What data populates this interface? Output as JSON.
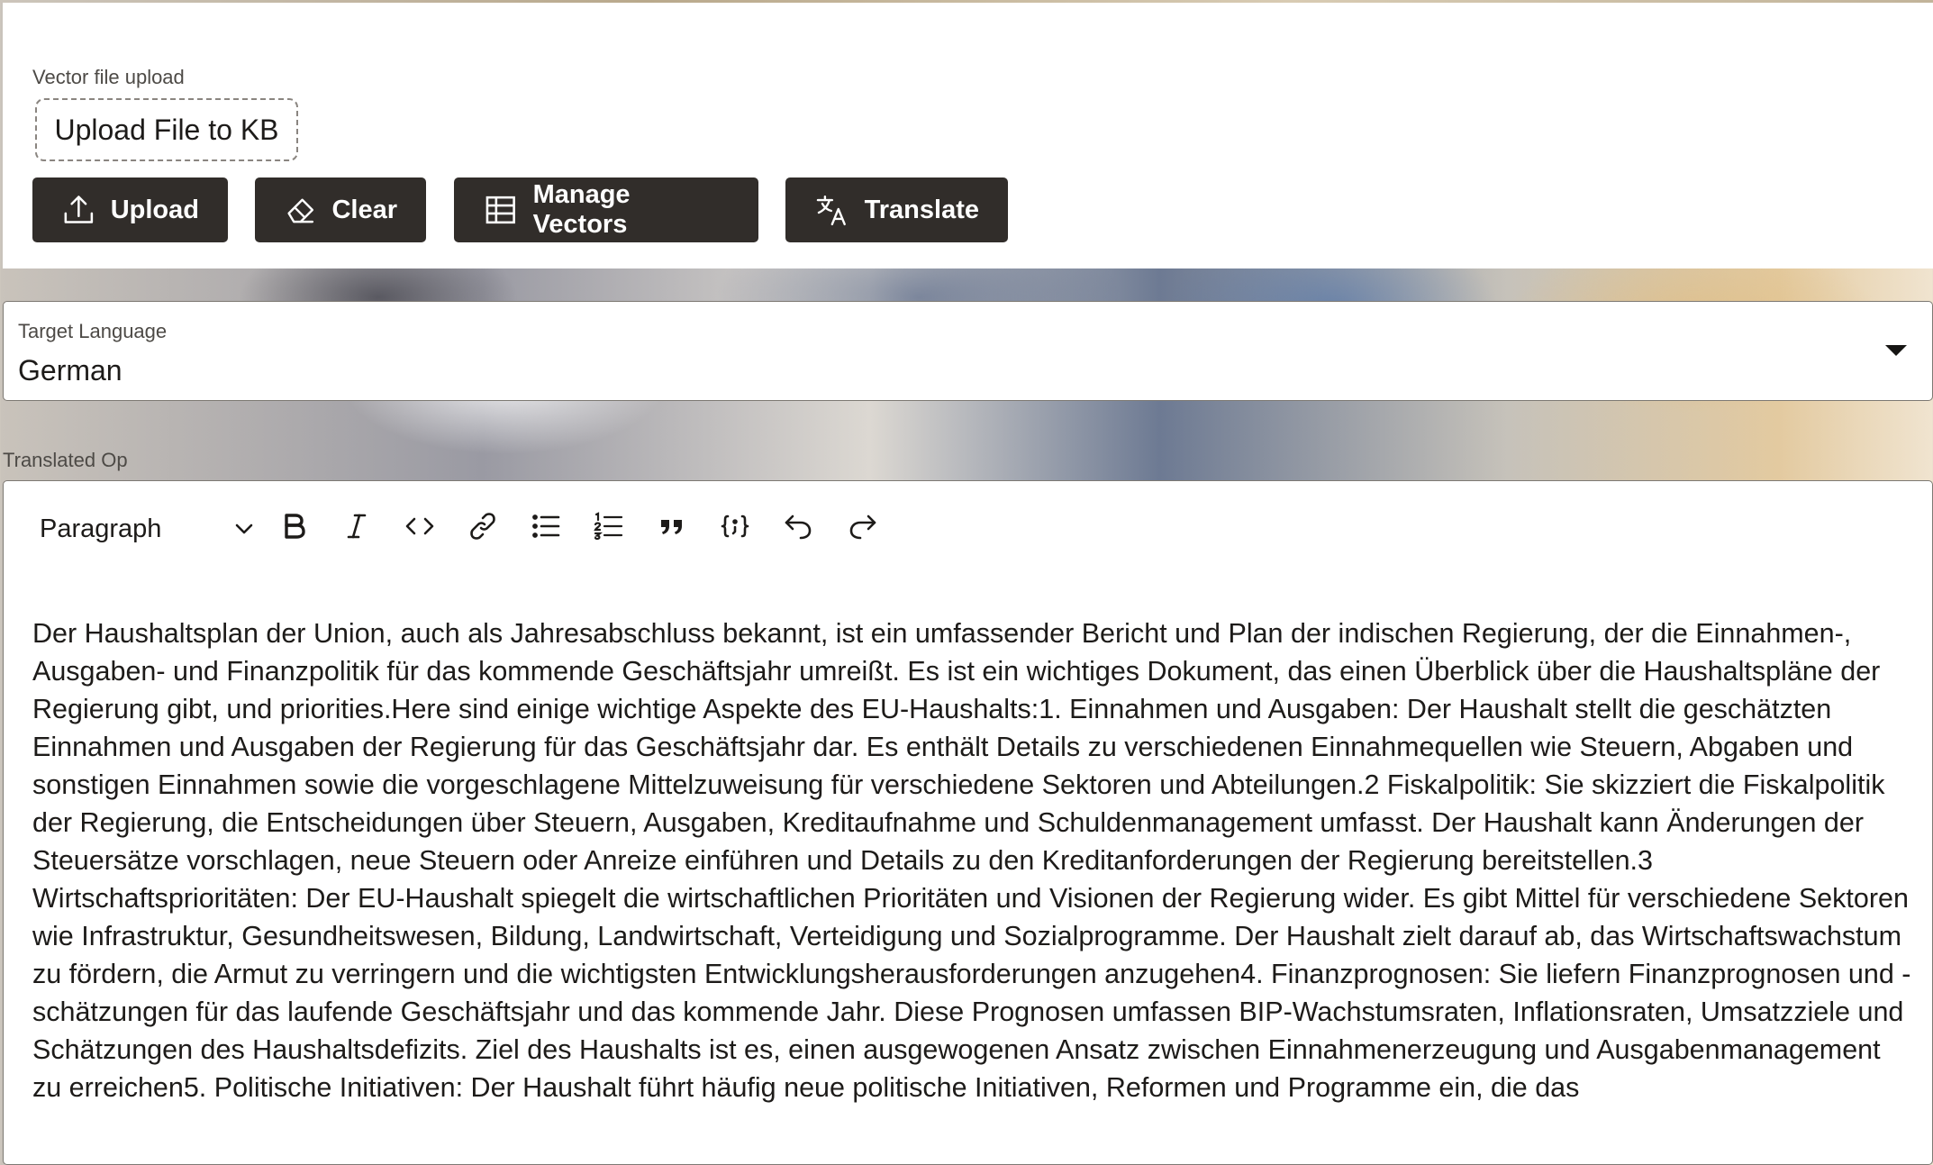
{
  "upload_section": {
    "label": "Vector file upload",
    "upload_box_text": "Upload File to KB",
    "buttons": [
      {
        "label": "Upload",
        "icon": "upload-icon"
      },
      {
        "label": "Clear",
        "icon": "eraser-icon"
      },
      {
        "label": "Manage Vectors",
        "icon": "table-icon"
      },
      {
        "label": "Translate",
        "icon": "translate-icon"
      }
    ]
  },
  "target_language": {
    "label": "Target Language",
    "value": "German"
  },
  "editor": {
    "label": "Translated Op",
    "block_format": "Paragraph",
    "toolbar_icons": [
      "bold-icon",
      "italic-icon",
      "code-icon",
      "link-icon",
      "bulleted-list-icon",
      "numbered-list-icon",
      "blockquote-icon",
      "code-block-icon",
      "undo-icon",
      "redo-icon"
    ],
    "content": "Der Haushaltsplan der Union, auch als Jahresabschluss bekannt, ist ein umfassender Bericht und Plan der indischen Regierung, der die Einnahmen-, Ausgaben- und Finanzpolitik für das kommende Geschäftsjahr umreißt. Es ist ein wichtiges Dokument, das einen Überblick über die Haushaltspläne der Regierung gibt, und priorities.Here sind einige wichtige Aspekte des EU-Haushalts:1. Einnahmen und Ausgaben: Der Haushalt stellt die geschätzten Einnahmen und Ausgaben der Regierung für das Geschäftsjahr dar. Es enthält Details zu verschiedenen Einnahmequellen wie Steuern, Abgaben und sonstigen Einnahmen sowie die vorgeschlagene Mittelzuweisung für verschiedene Sektoren und Abteilungen.2 Fiskalpolitik: Sie skizziert die Fiskalpolitik der Regierung, die Entscheidungen über Steuern, Ausgaben, Kreditaufnahme und Schuldenmanagement umfasst. Der Haushalt kann Änderungen der Steuersätze vorschlagen, neue Steuern oder Anreize einführen und Details zu den Kreditanforderungen der Regierung bereitstellen.3 Wirtschaftsprioritäten: Der EU-Haushalt spiegelt die wirtschaftlichen Prioritäten und Visionen der Regierung wider. Es gibt Mittel für verschiedene Sektoren wie Infrastruktur, Gesundheitswesen, Bildung, Landwirtschaft, Verteidigung und Sozialprogramme. Der Haushalt zielt darauf ab, das Wirtschaftswachstum zu fördern, die Armut zu verringern und die wichtigsten Entwicklungsherausforderungen anzugehen4. Finanzprognosen: Sie liefern Finanzprognosen und -schätzungen für das laufende Geschäftsjahr und das kommende Jahr. Diese Prognosen umfassen BIP-Wachstumsraten, Inflationsraten, Umsatzziele und Schätzungen des Haushaltsdefizits. Ziel des Haushalts ist es, einen ausgewogenen Ansatz zwischen Einnahmenerzeugung und Ausgabenmanagement zu erreichen5. Politische Initiativen: Der Haushalt führt häufig neue politische Initiativen, Reformen und Programme ein, die das"
  }
}
